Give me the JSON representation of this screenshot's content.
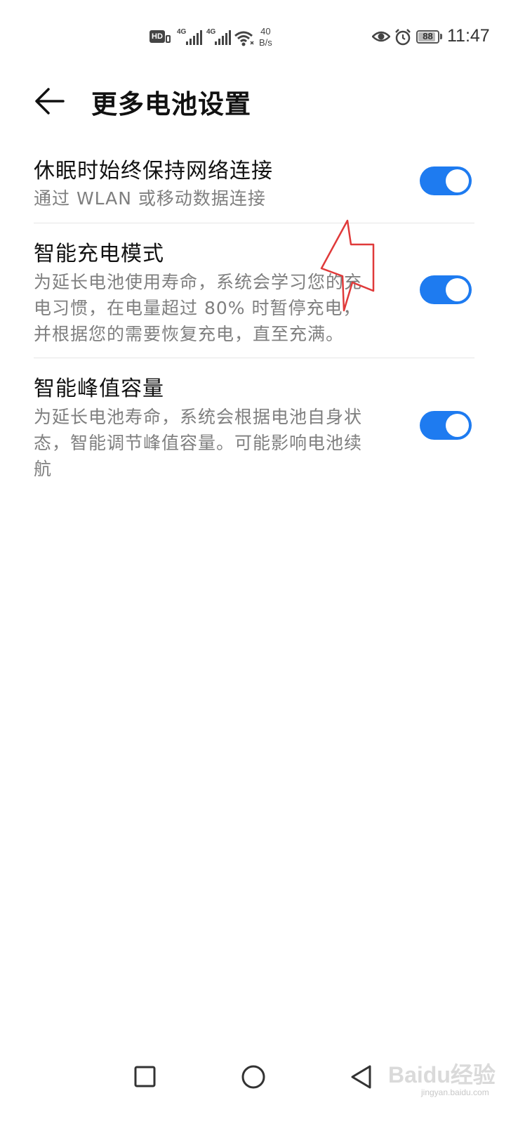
{
  "status_bar": {
    "hd_label": "HD",
    "net1": "4G",
    "net2": "4G",
    "speed_value": "40",
    "speed_unit": "B/s",
    "battery_level": "88",
    "time": "11:47",
    "icons": [
      "hd-volte-icon",
      "signal-icon",
      "wifi-icon",
      "eye-comfort-icon",
      "alarm-icon",
      "battery-icon"
    ]
  },
  "header": {
    "title": "更多电池设置",
    "back_icon": "arrow-left-icon"
  },
  "settings": [
    {
      "title": "休眠时始终保持网络连接",
      "description_lines": [
        "通过 WLAN 或移动数据连接"
      ],
      "enabled": true
    },
    {
      "title": "智能充电模式",
      "description_lines": [
        "为延长电池使用寿命，系统会学习您的充",
        "电习惯，在电量超过 80% 时暂停充电，",
        "并根据您的需要恢复充电，直至充满。"
      ],
      "enabled": true
    },
    {
      "title": "智能峰值容量",
      "description_lines": [
        "为延长电池寿命，系统会根据电池自身状",
        "态，智能调节峰值容量。可能影响电池续",
        "航"
      ],
      "enabled": true
    }
  ],
  "colors": {
    "toggle_on": "#1e7bf0",
    "annotation": "#e03a3a",
    "secondary_text": "#7f7f7f"
  },
  "nav_bar": {
    "buttons": [
      "recent-apps-icon",
      "home-icon",
      "back-triangle-icon"
    ]
  },
  "watermark": {
    "text": "Baidu经验",
    "sub": "jingyan.baidu.com"
  }
}
